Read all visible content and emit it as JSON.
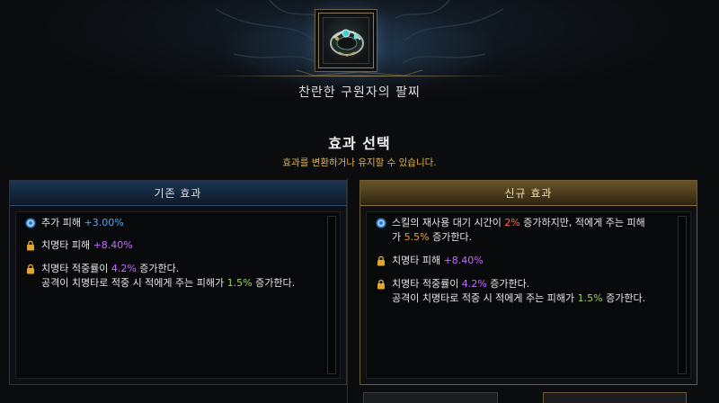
{
  "item": {
    "name": "찬란한 구원자의 팔찌",
    "icon": "bracelet-icon"
  },
  "header": {
    "title": "효과 선택",
    "subtitle": "효과를 변환하거나 유지할 수 있습니다."
  },
  "panels": {
    "old": {
      "title": "기존 효과",
      "effects": [
        {
          "icon": "shield-icon",
          "pre": "추가 피해 ",
          "v1": "+3.00%",
          "mid": "",
          "v2": "",
          "post": "",
          "line2pre": "",
          "line2v": "",
          "line2post": ""
        },
        {
          "icon": "lock-icon",
          "pre": "치명타 피해 ",
          "v1": "+8.40%",
          "mid": "",
          "v2": "",
          "post": "",
          "line2pre": "",
          "line2v": "",
          "line2post": ""
        },
        {
          "icon": "lock-icon",
          "pre": "치명타 적중률이 ",
          "v1": "4.2%",
          "mid": " 증가한다.",
          "v2": "",
          "post": "",
          "line2pre": "공격이 치명타로 적중 시 적에게 주는 피해가 ",
          "line2v": "1.5%",
          "line2post": " 증가한다."
        }
      ]
    },
    "new": {
      "title": "신규 효과",
      "effects": [
        {
          "icon": "shield-icon",
          "pre": "스킬의 재사용 대기 시간이 ",
          "v1": "2%",
          "mid": " 증가하지만, 적에게 주는 피해",
          "v2": "",
          "post": "",
          "line2pre": "가 ",
          "line2v": "5.5%",
          "line2post": " 증가한다."
        },
        {
          "icon": "lock-icon",
          "pre": "치명타 피해 ",
          "v1": "+8.40%",
          "mid": "",
          "v2": "",
          "post": "",
          "line2pre": "",
          "line2v": "",
          "line2post": ""
        },
        {
          "icon": "lock-icon",
          "pre": "치명타 적중률이 ",
          "v1": "4.2%",
          "mid": " 증가한다.",
          "v2": "",
          "post": "",
          "line2pre": "공격이 치명타로 적중 시 적에게 주는 피해가 ",
          "line2v": "1.5%",
          "line2post": " 증가한다."
        }
      ]
    }
  },
  "colors": {
    "gold_text": "#e6b44a",
    "blue_value": "#5aa6e6",
    "purple_value": "#c76dff",
    "green_value": "#9ad45a",
    "red_value": "#ff6a5a",
    "orange_value": "#e8a23a"
  }
}
